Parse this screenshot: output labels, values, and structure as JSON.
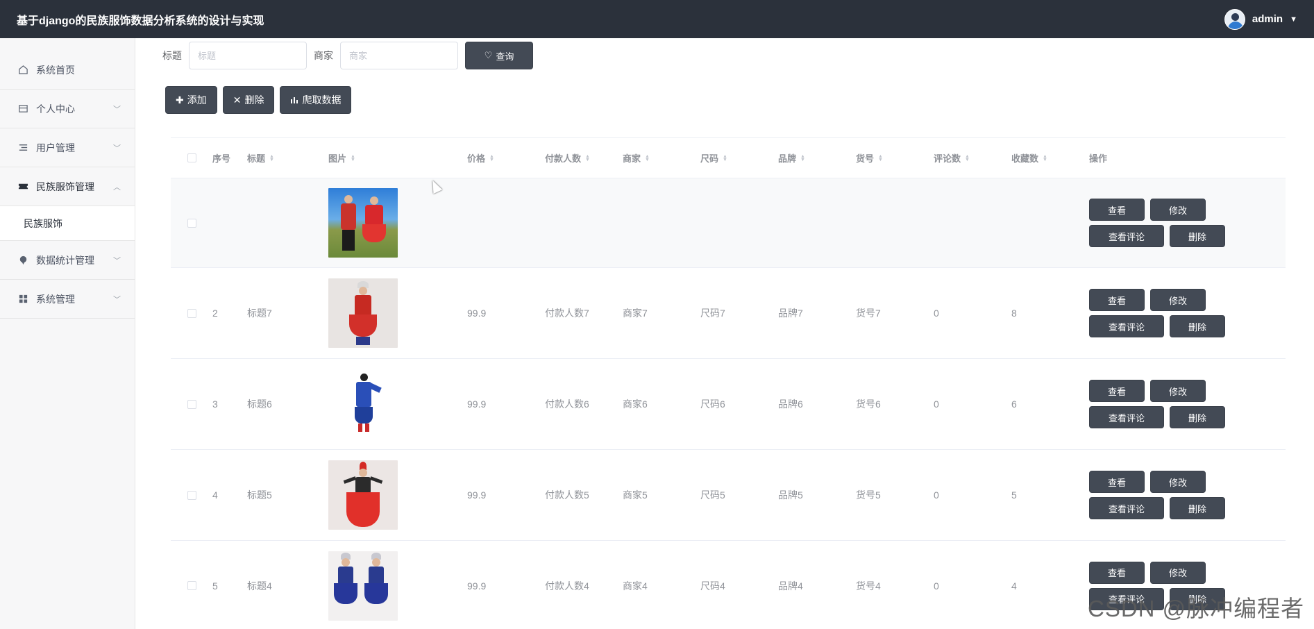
{
  "app": {
    "title": "基于django的民族服饰数据分析系统的设计与实现"
  },
  "user": {
    "name": "admin"
  },
  "sidebar": {
    "items": [
      {
        "label": "系统首页",
        "icon": "home-icon"
      },
      {
        "label": "个人中心",
        "icon": "wallet-icon"
      },
      {
        "label": "用户管理",
        "icon": "list-icon"
      },
      {
        "label": "民族服饰管理",
        "icon": "ticket-icon",
        "open": true
      },
      {
        "label": "数据统计管理",
        "icon": "pin-icon"
      },
      {
        "label": "系统管理",
        "icon": "grid-icon"
      }
    ],
    "sub_items": [
      "民族服饰"
    ]
  },
  "search": {
    "title_label": "标题",
    "title_placeholder": "标题",
    "shop_label": "商家",
    "shop_placeholder": "商家",
    "query_button": "查询"
  },
  "toolbar": {
    "add": "添加",
    "delete": "删除",
    "crawl": "爬取数据"
  },
  "table": {
    "columns": [
      "序号",
      "标题",
      "图片",
      "价格",
      "付款人数",
      "商家",
      "尺码",
      "品牌",
      "货号",
      "评论数",
      "收藏数",
      "操作"
    ],
    "rows": [
      {
        "idx": "",
        "title": "",
        "price": "",
        "pay": "",
        "shop": "",
        "size": "",
        "brand": "",
        "sku": "",
        "comments": "",
        "favorites": ""
      },
      {
        "idx": "2",
        "title": "标题7",
        "price": "99.9",
        "pay": "付款人数7",
        "shop": "商家7",
        "size": "尺码7",
        "brand": "品牌7",
        "sku": "货号7",
        "comments": "0",
        "favorites": "8"
      },
      {
        "idx": "3",
        "title": "标题6",
        "price": "99.9",
        "pay": "付款人数6",
        "shop": "商家6",
        "size": "尺码6",
        "brand": "品牌6",
        "sku": "货号6",
        "comments": "0",
        "favorites": "6"
      },
      {
        "idx": "4",
        "title": "标题5",
        "price": "99.9",
        "pay": "付款人数5",
        "shop": "商家5",
        "size": "尺码5",
        "brand": "品牌5",
        "sku": "货号5",
        "comments": "0",
        "favorites": "5"
      },
      {
        "idx": "5",
        "title": "标题4",
        "price": "99.9",
        "pay": "付款人数4",
        "shop": "商家4",
        "size": "尺码4",
        "brand": "品牌4",
        "sku": "货号4",
        "comments": "0",
        "favorites": "4"
      }
    ],
    "ops": {
      "view": "查看",
      "edit": "修改",
      "comments": "查看评论",
      "delete": "删除"
    }
  },
  "watermark": "CSDN @脉冲编程者"
}
